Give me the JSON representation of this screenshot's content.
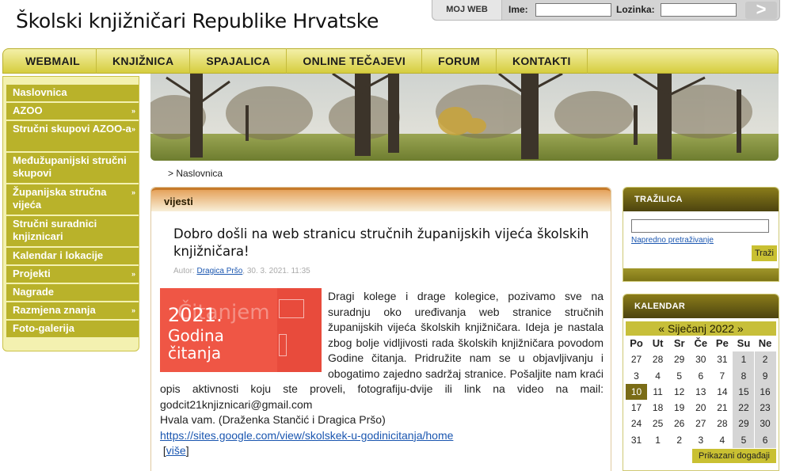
{
  "site": {
    "title": "Školski knjižničari Republike Hrvatske"
  },
  "login": {
    "moj_web": "MOJ WEB",
    "ime_label": "Ime:",
    "lozinka_label": "Lozinka:",
    "ime_value": "",
    "lozinka_value": "",
    "submit_glyph": ">"
  },
  "topnav": [
    "WEBMAIL",
    "KNJIŽNICA",
    "SPAJALICA",
    "ONLINE TEČAJEVI",
    "FORUM",
    "KONTAKTI"
  ],
  "leftmenu": [
    {
      "label": "Naslovnica",
      "has_sub": false
    },
    {
      "label": "AZOO",
      "has_sub": true
    },
    {
      "label": "Stručni skupovi AZOO-a",
      "has_sub": true
    },
    {
      "label": "Međužupanijski stručni skupovi",
      "has_sub": false
    },
    {
      "label": "Županijska stručna vijeća",
      "has_sub": true
    },
    {
      "label": "Stručni suradnici knjiznicari",
      "has_sub": false
    },
    {
      "label": "Kalendar i lokacije",
      "has_sub": false
    },
    {
      "label": "Projekti",
      "has_sub": true
    },
    {
      "label": "Nagrade",
      "has_sub": false
    },
    {
      "label": "Razmjena znanja",
      "has_sub": true
    },
    {
      "label": "Foto-galerija",
      "has_sub": false
    }
  ],
  "breadcrumb": "> Naslovnica",
  "news": {
    "section": "vijesti",
    "title": "Dobro došli na web stranicu stručnih županijskih vijeća školskih knjižničara!",
    "author_label": "Autor:",
    "author": "Dragica Pršo",
    "date": ", 30. 3. 2021. 11:35",
    "image_line1": "2021.",
    "image_line2": "Godina",
    "image_line3": "čitanja",
    "body": "Dragi kolege i drage kolegice, pozivamo sve na suradnju oko uređivanja web stranice stručnih županijskih vijeća školskih knjižničara. Ideja je nastala zbog bolje vidljivosti rada školskih knjižničara povodom Godine čitanja. Pridružite nam se u objavljivanju i obogatimo zajedno sadržaj stranice. Pošaljite nam kraći opis aktivnosti koju ste proveli, fotografiju-dvije ili link na video na mail: godcit21knjiznicari@gmail.com",
    "thanks": "Hvala vam. (Draženka Stančić i Dragica Pršo)",
    "link": "https://sites.google.com/view/skolskek-u-godinicitanja/home",
    "more_open": "[",
    "more": "više",
    "more_close": "]"
  },
  "search": {
    "heading": "TRAŽILICA",
    "value": "",
    "advanced": "Napredno pretraživanje",
    "button": "Traži"
  },
  "calendar": {
    "heading": "KALENDAR",
    "prev": "«",
    "month": "Siječanj 2022",
    "next": "»",
    "days": [
      "Po",
      "Ut",
      "Sr",
      "Če",
      "Pe",
      "Su",
      "Ne"
    ],
    "weeks": [
      [
        "27",
        "28",
        "29",
        "30",
        "31",
        "1",
        "2"
      ],
      [
        "3",
        "4",
        "5",
        "6",
        "7",
        "8",
        "9"
      ],
      [
        "10",
        "11",
        "12",
        "13",
        "14",
        "15",
        "16"
      ],
      [
        "17",
        "18",
        "19",
        "20",
        "21",
        "22",
        "23"
      ],
      [
        "24",
        "25",
        "26",
        "27",
        "28",
        "29",
        "30"
      ],
      [
        "31",
        "1",
        "2",
        "3",
        "4",
        "5",
        "6"
      ]
    ],
    "today": "10",
    "show_events": "Prikazani događaji"
  }
}
